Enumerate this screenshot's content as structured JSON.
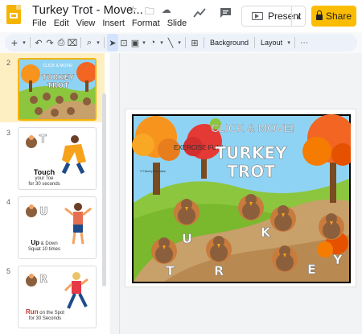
{
  "app": {
    "doc_title": "Turkey Trot - Move...",
    "menus": [
      "File",
      "Edit",
      "View",
      "Insert",
      "Format",
      "Slide"
    ],
    "present_label": "Present",
    "share_label": "Share"
  },
  "toolbar": {
    "background_label": "Background",
    "layout_label": "Layout"
  },
  "slides": [
    {
      "number": "2",
      "title_line1": "TURKEY",
      "title_line2": "TROT",
      "caption_small": "CLICK & MOVE!"
    },
    {
      "number": "3",
      "letter": "T",
      "caption_bold": "Touch",
      "caption_line1": "your Toe",
      "caption_line2": "for 30 seconds"
    },
    {
      "number": "4",
      "letter": "U",
      "caption_bold": "Up",
      "caption_mid": "& Down",
      "caption_line1": "Squat 10 times"
    },
    {
      "number": "5",
      "letter": "R",
      "caption_bold": "Run",
      "caption_mid": "on the Spot",
      "caption_line1": "for 30 Seconds"
    }
  ],
  "main_slide": {
    "click_move": "CLICK & MOVE!",
    "exercise_fun": "EXERCISE FUN!",
    "title_line1": "TURKEY",
    "title_line2": "TROT",
    "letters": [
      "T",
      "U",
      "R",
      "K",
      "E",
      "Y"
    ],
    "credit": "© Fisherly Education"
  },
  "colors": {
    "accent": "#fbbc04",
    "sky": "#8fd3f4",
    "grass": "#8cc63f",
    "path": "#c8a06a",
    "active_slide_bg": "#feefc3"
  }
}
